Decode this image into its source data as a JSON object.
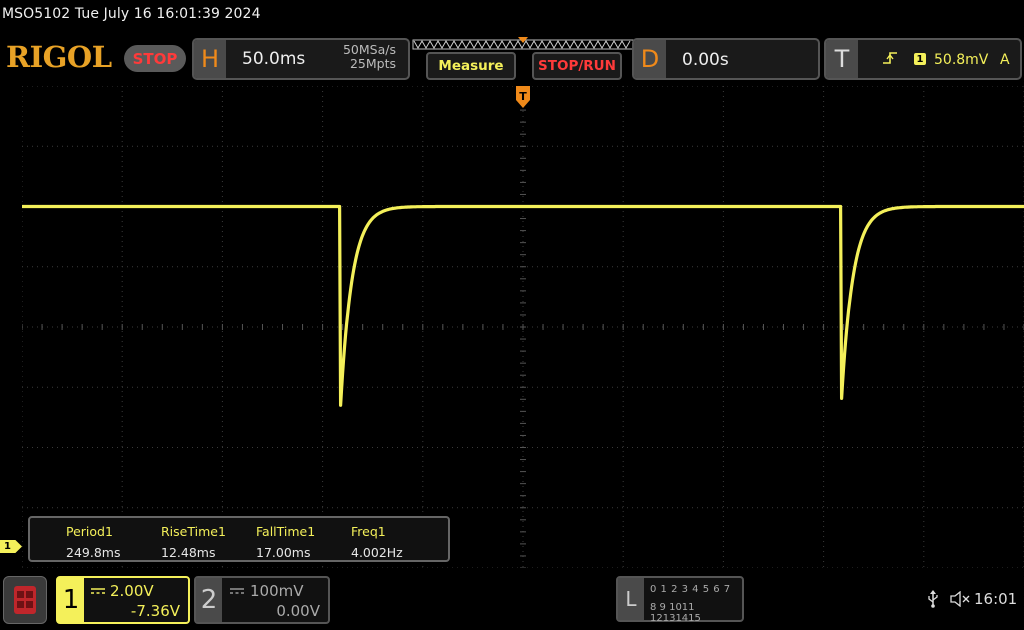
{
  "header": {
    "info": "MSO5102  Tue July 16 16:01:39 2024",
    "logo": "RIGOL",
    "run_state": "STOP"
  },
  "horizontal": {
    "key": "H",
    "timebase": "50.0ms",
    "sample_rate": "50MSa/s",
    "memory_depth": "25Mpts"
  },
  "buttons": {
    "measure": "Measure",
    "stop_run": "STOP/RUN"
  },
  "delay": {
    "key": "D",
    "value": "0.00s"
  },
  "trigger": {
    "key": "T",
    "edge_icon": "rising-edge-icon",
    "channel": "1",
    "level": "50.8mV",
    "mode": "A",
    "marker": "T"
  },
  "measurements": [
    {
      "name": "Period1",
      "value": "249.8ms"
    },
    {
      "name": "RiseTime1",
      "value": "12.48ms"
    },
    {
      "name": "FallTime1",
      "value": "17.00ms"
    },
    {
      "name": "Freq1",
      "value": "4.002Hz"
    }
  ],
  "channel1": {
    "number": "1",
    "scale": "2.00V",
    "offset": "-7.36V",
    "marker": "1",
    "color": "#f4f05a"
  },
  "channel2": {
    "number": "2",
    "scale": "100mV",
    "offset": "0.00V"
  },
  "logic": {
    "letter": "L",
    "row1": "0 1 2 3   4 5 6 7",
    "row2": "8 9 1011 12131415"
  },
  "status": {
    "time": "16:01"
  },
  "waveform": {
    "type": "square",
    "period_ms": 249.8,
    "rise_time_ms": 12.48,
    "fall_time_ms": 17.0,
    "frequency_hz": 4.002,
    "low_div": -1.3,
    "high_div": 2.0,
    "time_per_div_ms": 50.0,
    "first_rise_div_from_left": 3.18,
    "first_fall_div_from_left": 9.9
  }
}
